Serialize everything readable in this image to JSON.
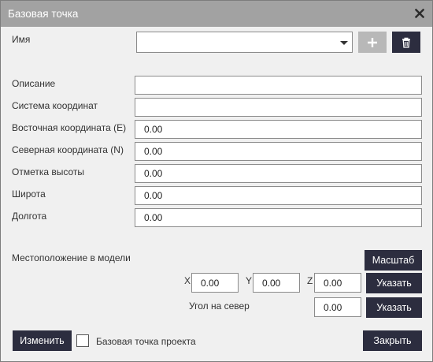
{
  "window": {
    "title": "Базовая точка",
    "close_icon": "close-icon"
  },
  "name_row": {
    "label": "Имя",
    "value": "",
    "add_icon": "plus-icon",
    "delete_icon": "trash-icon"
  },
  "fields": {
    "description": {
      "label": "Описание",
      "value": ""
    },
    "coord_system": {
      "label": "Система координат",
      "value": ""
    },
    "easting": {
      "label": "Восточная координата  (E)",
      "value": "0.00"
    },
    "northing": {
      "label": "Северная координата  (N)",
      "value": "0.00"
    },
    "elevation": {
      "label": "Отметка высоты",
      "value": "0.00"
    },
    "latitude": {
      "label": "Широта",
      "value": "0.00"
    },
    "longitude": {
      "label": "Долгота",
      "value": "0.00"
    }
  },
  "model_location": {
    "label": "Местоположение в модели",
    "scale_button": "Масштаб",
    "x_label": "X",
    "x_value": "0.00",
    "y_label": "Y",
    "y_value": "0.00",
    "z_label": "Z",
    "z_value": "0.00",
    "pick_button": "Указать",
    "north_angle_label": "Угол на север",
    "north_angle_value": "0.00",
    "north_pick_button": "Указать"
  },
  "footer": {
    "modify_button": "Изменить",
    "project_base_point_label": "Базовая точка проекта",
    "project_base_point_checked": false,
    "close_button": "Закрыть"
  },
  "colors": {
    "titlebar": "#a2a2a2",
    "button_dark": "#2c2d3f",
    "button_disabled": "#b8b8b8",
    "background": "#f0f0f0"
  }
}
